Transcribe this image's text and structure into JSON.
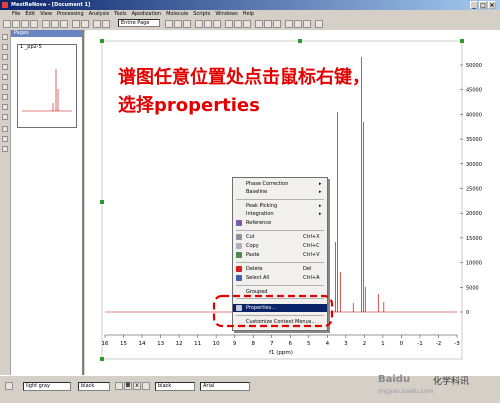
{
  "window": {
    "title": "MestReNova - [Document 1]"
  },
  "menu": {
    "items": [
      "File",
      "Edit",
      "View",
      "Processing",
      "Analysis",
      "Tools",
      "Apodization",
      "Molecule",
      "Scripts",
      "Windows",
      "Help"
    ]
  },
  "toolbar": {
    "page_combo": "Entire Page"
  },
  "pages_panel": {
    "title": "Pages",
    "thumb_label": "1 _pp2-5"
  },
  "spectrum": {
    "x_ticks": [
      "16",
      "15",
      "14",
      "13",
      "12",
      "11",
      "10",
      "9",
      "8",
      "7",
      "6",
      "5",
      "4",
      "3",
      "2",
      "1",
      "0",
      "-1",
      "-2",
      "-3"
    ],
    "x_label": "f1 (ppm)",
    "y_ticks": [
      "50000",
      "45000",
      "40000",
      "35000",
      "30000",
      "25000",
      "20000",
      "15000",
      "10000",
      "5000",
      "0"
    ]
  },
  "context_menu": {
    "items": [
      {
        "label": "Phase Correction",
        "submenu": true
      },
      {
        "label": "Baseline",
        "submenu": true
      },
      {
        "label": "Peak Picking",
        "submenu": true
      },
      {
        "label": "Integration",
        "submenu": true
      },
      {
        "label": "Reference",
        "icon": "reference-icon"
      },
      {
        "label": "Cut",
        "shortcut": "Ctrl+X",
        "icon": "cut-icon"
      },
      {
        "label": "Copy",
        "shortcut": "Ctrl+C",
        "icon": "copy-icon"
      },
      {
        "label": "Paste",
        "shortcut": "Ctrl+V",
        "icon": "paste-icon"
      },
      {
        "label": "Delete",
        "shortcut": "Del",
        "icon": "delete-icon"
      },
      {
        "label": "Select All",
        "shortcut": "Ctrl+A",
        "icon": "select-all-icon"
      },
      {
        "label": "Grouped"
      },
      {
        "label": "Properties...",
        "highlighted": true,
        "icon": "properties-icon"
      },
      {
        "label": "Customize Context Menus..."
      }
    ]
  },
  "statusbar": {
    "line_color": "light gray",
    "fill_color": "black",
    "text_color": "black",
    "font": "Arial"
  },
  "overlay": {
    "line1": "谱图任意位置处点击鼠标右键，",
    "line2": "选择properties"
  },
  "watermark": {
    "brand": "Baidu",
    "account": "化学科讯",
    "sub": "jingyan.baidu.com"
  },
  "colors": {
    "accent_red": "#e30000",
    "spectrum_red": "#cc0000",
    "highlight": "#0a246a"
  }
}
